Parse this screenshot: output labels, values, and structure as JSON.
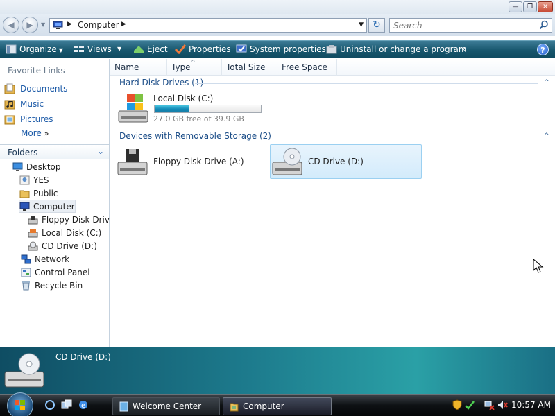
{
  "window": {
    "controls": {
      "minimize": "—",
      "maximize": "❐",
      "close": "✕"
    }
  },
  "address": {
    "back": "◀",
    "forward": "▶",
    "separator": "▶",
    "crumb": "Computer",
    "dropdown": "▼",
    "refresh": "↻",
    "search_placeholder": "Search"
  },
  "commandbar": {
    "organize": "Organize",
    "views": "Views",
    "eject": "Eject",
    "properties": "Properties",
    "system_properties": "System properties",
    "uninstall": "Uninstall or change a program",
    "overflow": "»",
    "help": "?",
    "dropdown_glyph": "▼"
  },
  "sidebar": {
    "favorites_title": "Favorite Links",
    "favorites": [
      "Documents",
      "Music",
      "Pictures"
    ],
    "more": "More",
    "more_glyph": "»",
    "folders_label": "Folders",
    "folders_chevron": "⌄",
    "tree": [
      "Desktop",
      "YES",
      "Public",
      "Computer",
      "Floppy Disk Drive",
      "Local Disk (C:)",
      "CD Drive (D:)",
      "Network",
      "Control Panel",
      "Recycle Bin"
    ],
    "selected_tree_item": "Computer"
  },
  "columns": [
    "Name",
    "Type",
    "Total Size",
    "Free Space"
  ],
  "sort_glyph": "^",
  "groups": {
    "hard_disks": {
      "title": "Hard Disk Drives (1)",
      "chevron": "^"
    },
    "removable": {
      "title": "Devices with Removable Storage (2)",
      "chevron": "^"
    }
  },
  "drives": {
    "local": {
      "name": "Local Disk (C:)",
      "free_text": "27.0 GB free of 39.9 GB",
      "used_fraction": 0.323
    },
    "floppy": {
      "name": "Floppy Disk Drive (A:)"
    },
    "cd": {
      "name": "CD Drive (D:)"
    }
  },
  "details": {
    "title": "CD Drive (D:)"
  },
  "taskbar": {
    "buttons": [
      "Welcome Center",
      "Computer"
    ],
    "active": "Computer",
    "clock": "10:57 AM"
  },
  "colors": {
    "accent_blue": "#1d5ba8",
    "command_bar": "#17566d",
    "selection": "#d3ebfb",
    "usage_bar": "#1188b5"
  }
}
